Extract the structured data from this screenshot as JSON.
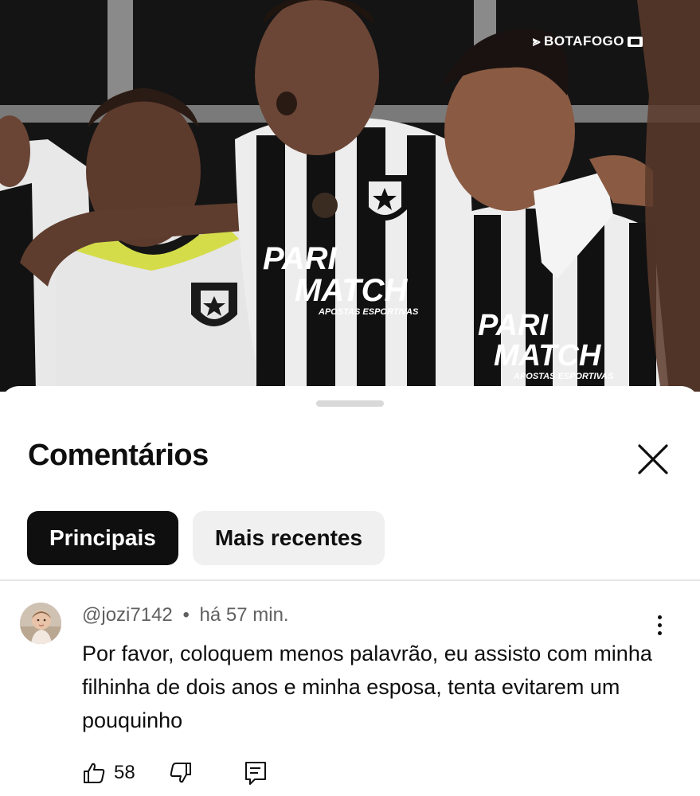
{
  "video": {
    "watermark": "BOTAFOGO",
    "jersey_sponsor_line1": "PARI",
    "jersey_sponsor_line2": "MATCH",
    "jersey_sponsor_sub": "APOSTAS ESPORTIVAS",
    "colors": {
      "background": "#151515",
      "jersey_dark": "#111111",
      "jersey_light": "#ececec",
      "skin": "#6b4636"
    }
  },
  "comments_panel": {
    "title": "Comentários",
    "close_icon": "close-icon",
    "filters": [
      {
        "label": "Principais",
        "active": true
      },
      {
        "label": "Mais recentes",
        "active": false
      }
    ]
  },
  "comment": {
    "author": "@jozi7142",
    "separator": "•",
    "time": "há 57 min.",
    "text": "Por favor, coloquem menos palavrão, eu assisto com minha filhinha de dois anos e minha esposa, tenta evitarem um pouquinho",
    "likes": "58",
    "icons": [
      "thumb-up-icon",
      "thumb-down-icon",
      "reply-icon",
      "more-vert-icon"
    ]
  },
  "colors": {
    "text_primary": "#0f0f0f",
    "text_secondary": "#606060",
    "chip_active": "#0f0f0f",
    "chip_inactive": "#f0f0f0"
  }
}
